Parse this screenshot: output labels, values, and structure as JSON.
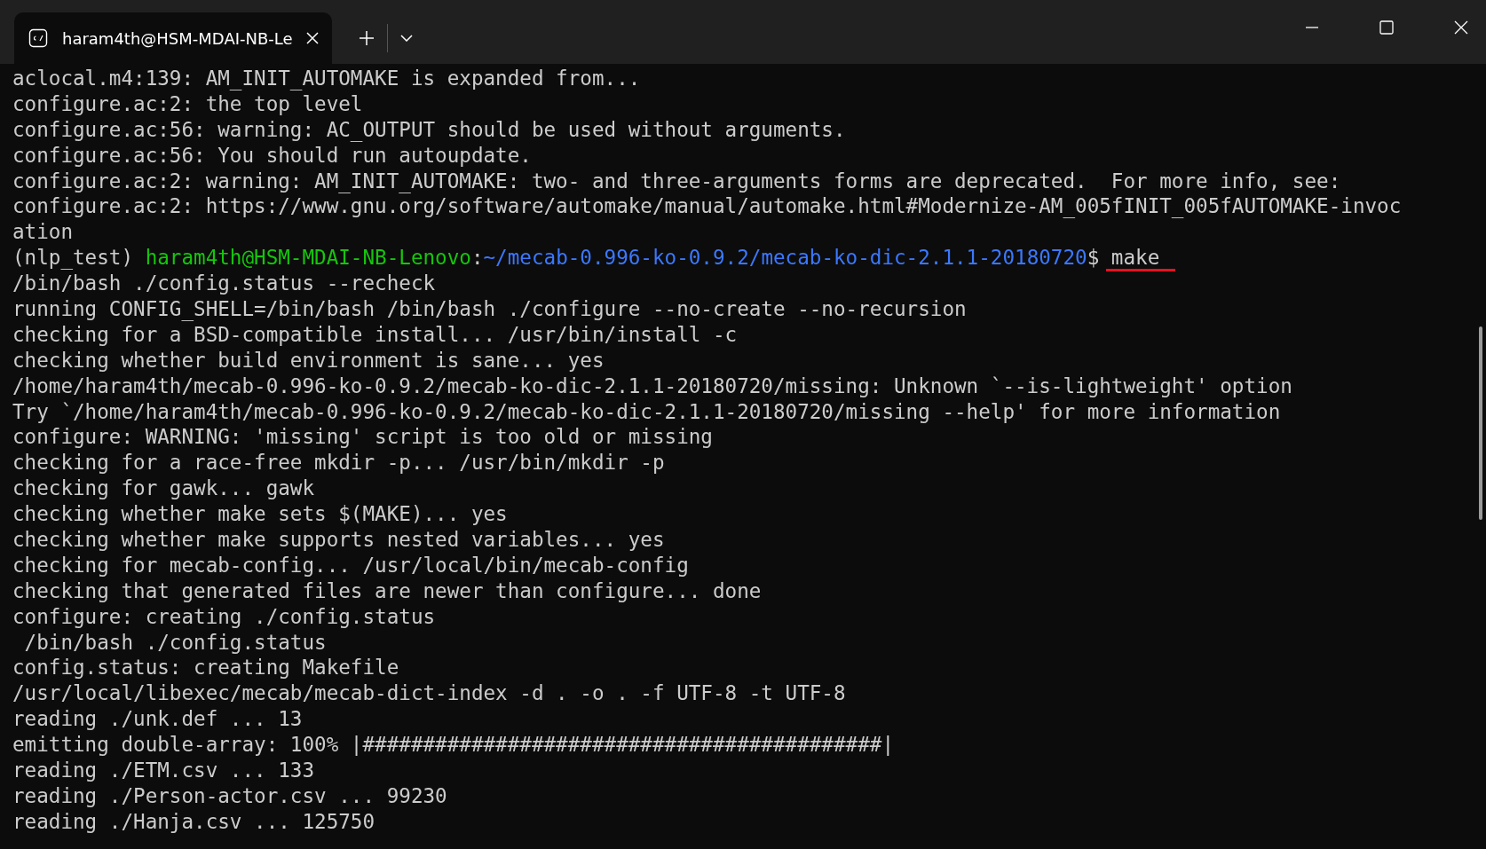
{
  "tab": {
    "title": "haram4th@HSM-MDAI-NB-Le",
    "selected": true
  },
  "lines": [
    {
      "kind": "text",
      "text": "aclocal.m4:139: AM_INIT_AUTOMAKE is expanded from..."
    },
    {
      "kind": "text",
      "text": "configure.ac:2: the top level"
    },
    {
      "kind": "text",
      "text": "configure.ac:56: warning: AC_OUTPUT should be used without arguments."
    },
    {
      "kind": "text",
      "text": "configure.ac:56: You should run autoupdate."
    },
    {
      "kind": "text",
      "text": "configure.ac:2: warning: AM_INIT_AUTOMAKE: two- and three-arguments forms are deprecated.  For more info, see:"
    },
    {
      "kind": "text",
      "text": "configure.ac:2: https://www.gnu.org/software/automake/manual/automake.html#Modernize-AM_005fINIT_005fAUTOMAKE-invoc"
    },
    {
      "kind": "text",
      "text": "ation"
    },
    {
      "kind": "prompt",
      "env": "(nlp_test)",
      "user_host": "haram4th@HSM-MDAI-NB-Lenovo",
      "separator": ":",
      "path": "~/mecab-0.996-ko-0.9.2/mecab-ko-dic-2.1.1-20180720",
      "symbol": "$",
      "command": "make",
      "underlined": true
    },
    {
      "kind": "text",
      "text": "/bin/bash ./config.status --recheck"
    },
    {
      "kind": "text",
      "text": "running CONFIG_SHELL=/bin/bash /bin/bash ./configure --no-create --no-recursion"
    },
    {
      "kind": "text",
      "text": "checking for a BSD-compatible install... /usr/bin/install -c"
    },
    {
      "kind": "text",
      "text": "checking whether build environment is sane... yes"
    },
    {
      "kind": "text",
      "text": "/home/haram4th/mecab-0.996-ko-0.9.2/mecab-ko-dic-2.1.1-20180720/missing: Unknown `--is-lightweight' option"
    },
    {
      "kind": "text",
      "text": "Try `/home/haram4th/mecab-0.996-ko-0.9.2/mecab-ko-dic-2.1.1-20180720/missing --help' for more information"
    },
    {
      "kind": "text",
      "text": "configure: WARNING: 'missing' script is too old or missing"
    },
    {
      "kind": "text",
      "text": "checking for a race-free mkdir -p... /usr/bin/mkdir -p"
    },
    {
      "kind": "text",
      "text": "checking for gawk... gawk"
    },
    {
      "kind": "text",
      "text": "checking whether make sets $(MAKE)... yes"
    },
    {
      "kind": "text",
      "text": "checking whether make supports nested variables... yes"
    },
    {
      "kind": "text",
      "text": "checking for mecab-config... /usr/local/bin/mecab-config"
    },
    {
      "kind": "text",
      "text": "checking that generated files are newer than configure... done"
    },
    {
      "kind": "text",
      "text": "configure: creating ./config.status"
    },
    {
      "kind": "text",
      "text": " /bin/bash ./config.status"
    },
    {
      "kind": "text",
      "text": "config.status: creating Makefile"
    },
    {
      "kind": "text",
      "text": "/usr/local/libexec/mecab/mecab-dict-index -d . -o . -f UTF-8 -t UTF-8"
    },
    {
      "kind": "text",
      "text": "reading ./unk.def ... 13"
    },
    {
      "kind": "text",
      "text": "emitting double-array: 100% |###########################################|"
    },
    {
      "kind": "text",
      "text": "reading ./ETM.csv ... 133"
    },
    {
      "kind": "text",
      "text": "reading ./Person-actor.csv ... 99230"
    },
    {
      "kind": "text",
      "text": "reading ./Hanja.csv ... 125750"
    }
  ]
}
